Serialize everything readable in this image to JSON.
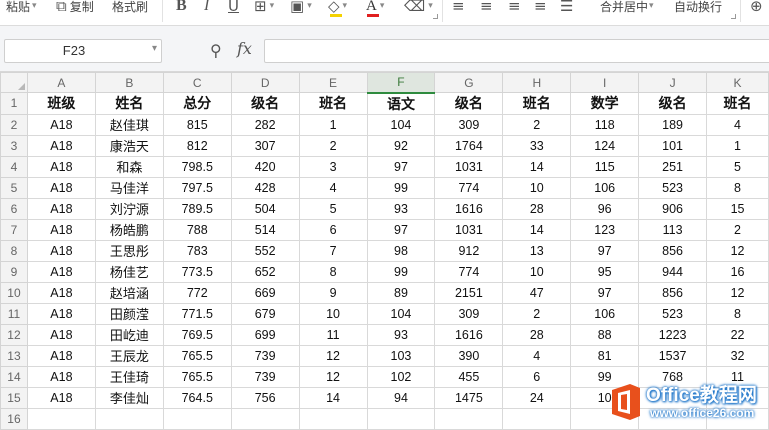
{
  "ribbon": {
    "paste_label": "粘贴",
    "copy_label": "复制",
    "format_painter_label": "格式刷",
    "bold_icon": "B",
    "italic_icon": "I",
    "underline_icon": "U",
    "merge_center_label": "合并居中",
    "wrap_text_label": "自动换行",
    "font_color": "#e02020",
    "fill_color": "#f5d200"
  },
  "formula_bar": {
    "name_box_value": "F23",
    "fx_label": "fx",
    "formula_value": ""
  },
  "sheet": {
    "selected_column": "F",
    "column_headers": [
      "A",
      "B",
      "C",
      "D",
      "E",
      "F",
      "G",
      "H",
      "I",
      "J",
      "K"
    ],
    "row_numbers": [
      "1",
      "2",
      "3",
      "4",
      "5",
      "6",
      "7",
      "8",
      "9",
      "10",
      "11",
      "12",
      "13",
      "14",
      "15",
      "16"
    ],
    "rows": [
      [
        "班级",
        "姓名",
        "总分",
        "级名",
        "班名",
        "语文",
        "级名",
        "班名",
        "数学",
        "级名",
        "班名"
      ],
      [
        "A18",
        "赵佳琪",
        "815",
        "282",
        "1",
        "104",
        "309",
        "2",
        "118",
        "189",
        "4"
      ],
      [
        "A18",
        "康浩天",
        "812",
        "307",
        "2",
        "92",
        "1764",
        "33",
        "124",
        "101",
        "1"
      ],
      [
        "A18",
        "和森",
        "798.5",
        "420",
        "3",
        "97",
        "1031",
        "14",
        "115",
        "251",
        "5"
      ],
      [
        "A18",
        "马佳洋",
        "797.5",
        "428",
        "4",
        "99",
        "774",
        "10",
        "106",
        "523",
        "8"
      ],
      [
        "A18",
        "刘泞源",
        "789.5",
        "504",
        "5",
        "93",
        "1616",
        "28",
        "96",
        "906",
        "15"
      ],
      [
        "A18",
        "杨皓鹏",
        "788",
        "514",
        "6",
        "97",
        "1031",
        "14",
        "123",
        "113",
        "2"
      ],
      [
        "A18",
        "王思彤",
        "783",
        "552",
        "7",
        "98",
        "912",
        "13",
        "97",
        "856",
        "12"
      ],
      [
        "A18",
        "杨佳艺",
        "773.5",
        "652",
        "8",
        "99",
        "774",
        "10",
        "95",
        "944",
        "16"
      ],
      [
        "A18",
        "赵培涵",
        "772",
        "669",
        "9",
        "89",
        "2151",
        "47",
        "97",
        "856",
        "12"
      ],
      [
        "A18",
        "田颜滢",
        "771.5",
        "679",
        "10",
        "104",
        "309",
        "2",
        "106",
        "523",
        "8"
      ],
      [
        "A18",
        "田屹迪",
        "769.5",
        "699",
        "11",
        "93",
        "1616",
        "28",
        "88",
        "1223",
        "22"
      ],
      [
        "A18",
        "王辰龙",
        "765.5",
        "739",
        "12",
        "103",
        "390",
        "4",
        "81",
        "1537",
        "32"
      ],
      [
        "A18",
        "王佳琦",
        "765.5",
        "739",
        "12",
        "102",
        "455",
        "6",
        "99",
        "768",
        "11"
      ],
      [
        "A18",
        "李佳灿",
        "764.5",
        "756",
        "14",
        "94",
        "1475",
        "24",
        "10",
        "",
        ""
      ],
      [
        "",
        "",
        "",
        "",
        "",
        "",
        "",
        "",
        "",
        "",
        ""
      ]
    ]
  },
  "watermark": {
    "brand": "Office教程网",
    "url": "www.office26.com",
    "brand_color": "#1a73c9",
    "logo_color": "#e8501c"
  }
}
